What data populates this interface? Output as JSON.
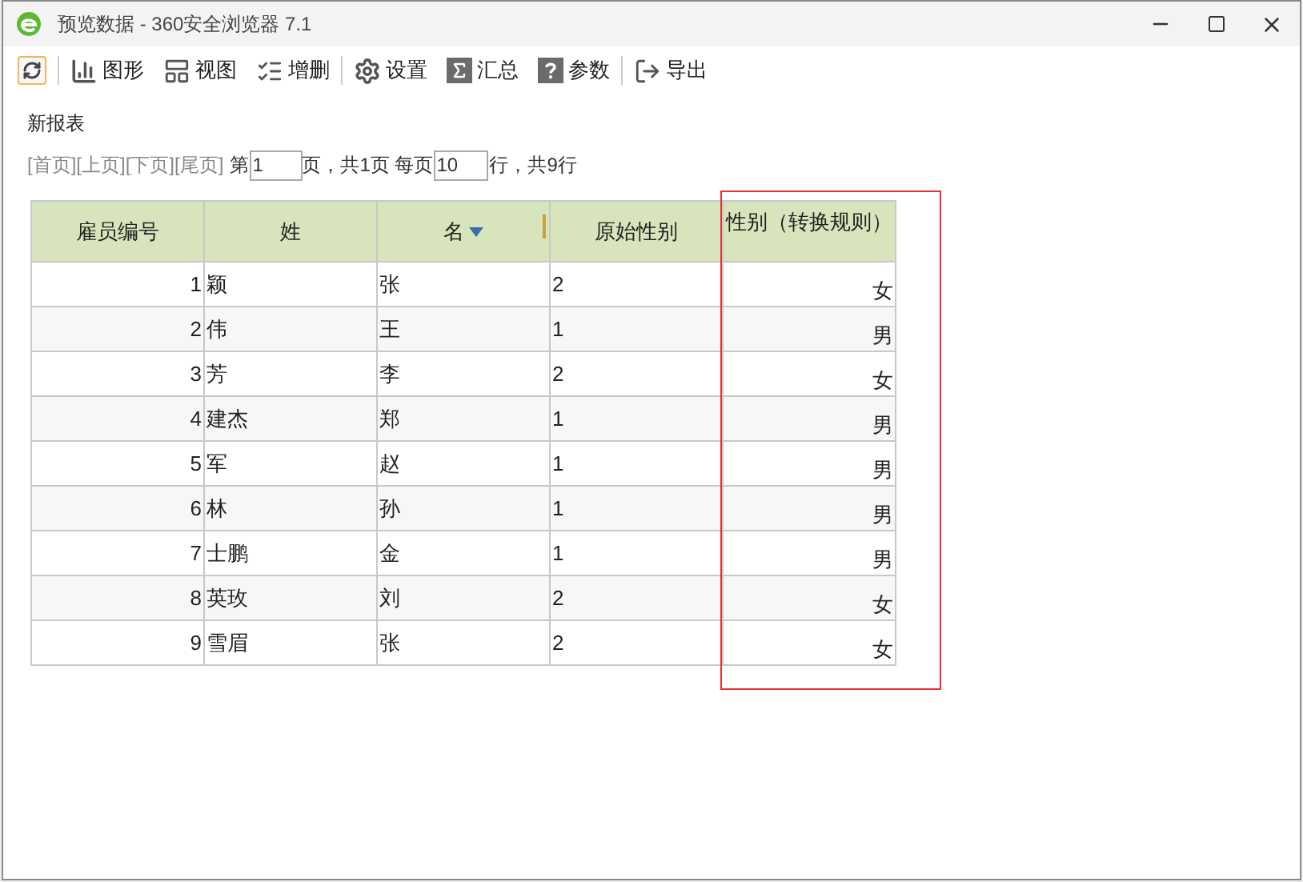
{
  "window": {
    "title": "预览数据 - 360安全浏览器 7.1"
  },
  "toolbar": {
    "items": [
      {
        "label": "图形",
        "divider_before": true
      },
      {
        "label": "视图",
        "divider_before": false
      },
      {
        "label": "增删",
        "divider_before": false
      },
      {
        "label": "设置",
        "divider_before": true
      },
      {
        "label": "汇总",
        "divider_before": false
      },
      {
        "label": "参数",
        "divider_before": false
      },
      {
        "label": "导出",
        "divider_before": true
      }
    ]
  },
  "report": {
    "title": "新报表"
  },
  "pager": {
    "nav_links": [
      "[首页]",
      "[上页]",
      "[下页]",
      "[尾页]"
    ],
    "page_prefix": "第",
    "page_value": "1",
    "page_suffix": "页，共1页 每页",
    "per_page_value": "10",
    "per_page_suffix": "行，共9行"
  },
  "table": {
    "columns": [
      {
        "label": "雇员编号",
        "sorted": false,
        "highlighted": false
      },
      {
        "label": "姓",
        "sorted": false,
        "highlighted": false
      },
      {
        "label": "名",
        "sorted": true,
        "highlighted": false
      },
      {
        "label": "原始性别",
        "sorted": false,
        "highlighted": false
      },
      {
        "label": "性别（转换规则）",
        "sorted": false,
        "highlighted": true
      }
    ],
    "rows": [
      [
        "1",
        "颖",
        "张",
        "2",
        "女"
      ],
      [
        "2",
        "伟",
        "王",
        "1",
        "男"
      ],
      [
        "3",
        "芳",
        "李",
        "2",
        "女"
      ],
      [
        "4",
        "建杰",
        "郑",
        "1",
        "男"
      ],
      [
        "5",
        "军",
        "赵",
        "1",
        "男"
      ],
      [
        "6",
        "林",
        "孙",
        "1",
        "男"
      ],
      [
        "7",
        "士鹏",
        "金",
        "1",
        "男"
      ],
      [
        "8",
        "英玫",
        "刘",
        "2",
        "女"
      ],
      [
        "9",
        "雪眉",
        "张",
        "2",
        "女"
      ]
    ]
  }
}
